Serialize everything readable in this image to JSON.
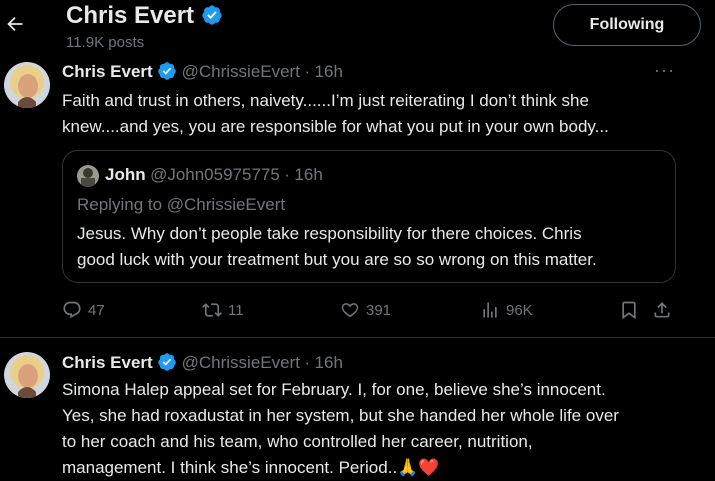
{
  "header": {
    "name": "Chris Evert",
    "posts_count": "11.9K posts",
    "follow_label": "Following"
  },
  "tweet1": {
    "name": "Chris Evert",
    "handle": "@ChrissieEvert",
    "separator": "·",
    "time": "16h",
    "text_line1": "Faith and trust in others, naivety......I’m just reiterating I don’t think she",
    "text_line2": "knew....and yes, you are responsible for what you put in your own body...",
    "quote": {
      "name": "John",
      "handle": "@John05975775",
      "separator": "·",
      "time": "16h",
      "replying_to": "Replying to @ChrissieEvert",
      "text_line1": "Jesus. Why don’t people take responsibility for there choices. Chris",
      "text_line2": "good luck with your treatment but you are so so wrong on this matter."
    },
    "actions": {
      "replies": "47",
      "reposts": "11",
      "likes": "391",
      "views": "96K"
    }
  },
  "tweet2": {
    "name": "Chris Evert",
    "handle": "@ChrissieEvert",
    "separator": "·",
    "time": "16h",
    "text_line1": "Simona Halep appeal set for February. I, for one, believe she’s innocent.",
    "text_line2": "Yes, she had roxadustat in her system, but she handed her whole life over",
    "text_line3": "to her coach and his team, who controlled her career, nutrition,",
    "text_line4": "management. I think she’s innocent. Period..",
    "emoji": "🙏❤️"
  },
  "colors": {
    "background": "#000000",
    "text": "#e7e9ea",
    "muted": "#71767b",
    "verified": "#1d9bf0",
    "border": "#2f3336"
  }
}
